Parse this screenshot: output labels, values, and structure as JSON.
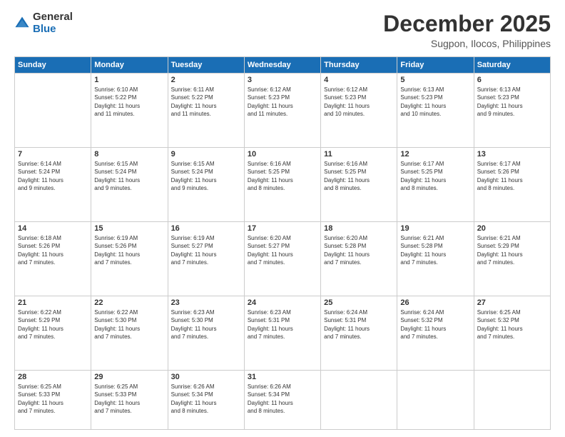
{
  "logo": {
    "general": "General",
    "blue": "Blue"
  },
  "title": "December 2025",
  "subtitle": "Sugpon, Ilocos, Philippines",
  "headers": [
    "Sunday",
    "Monday",
    "Tuesday",
    "Wednesday",
    "Thursday",
    "Friday",
    "Saturday"
  ],
  "weeks": [
    [
      {
        "day": "",
        "info": ""
      },
      {
        "day": "1",
        "info": "Sunrise: 6:10 AM\nSunset: 5:22 PM\nDaylight: 11 hours\nand 11 minutes."
      },
      {
        "day": "2",
        "info": "Sunrise: 6:11 AM\nSunset: 5:22 PM\nDaylight: 11 hours\nand 11 minutes."
      },
      {
        "day": "3",
        "info": "Sunrise: 6:12 AM\nSunset: 5:23 PM\nDaylight: 11 hours\nand 11 minutes."
      },
      {
        "day": "4",
        "info": "Sunrise: 6:12 AM\nSunset: 5:23 PM\nDaylight: 11 hours\nand 10 minutes."
      },
      {
        "day": "5",
        "info": "Sunrise: 6:13 AM\nSunset: 5:23 PM\nDaylight: 11 hours\nand 10 minutes."
      },
      {
        "day": "6",
        "info": "Sunrise: 6:13 AM\nSunset: 5:23 PM\nDaylight: 11 hours\nand 9 minutes."
      }
    ],
    [
      {
        "day": "7",
        "info": "Sunrise: 6:14 AM\nSunset: 5:24 PM\nDaylight: 11 hours\nand 9 minutes."
      },
      {
        "day": "8",
        "info": "Sunrise: 6:15 AM\nSunset: 5:24 PM\nDaylight: 11 hours\nand 9 minutes."
      },
      {
        "day": "9",
        "info": "Sunrise: 6:15 AM\nSunset: 5:24 PM\nDaylight: 11 hours\nand 9 minutes."
      },
      {
        "day": "10",
        "info": "Sunrise: 6:16 AM\nSunset: 5:25 PM\nDaylight: 11 hours\nand 8 minutes."
      },
      {
        "day": "11",
        "info": "Sunrise: 6:16 AM\nSunset: 5:25 PM\nDaylight: 11 hours\nand 8 minutes."
      },
      {
        "day": "12",
        "info": "Sunrise: 6:17 AM\nSunset: 5:25 PM\nDaylight: 11 hours\nand 8 minutes."
      },
      {
        "day": "13",
        "info": "Sunrise: 6:17 AM\nSunset: 5:26 PM\nDaylight: 11 hours\nand 8 minutes."
      }
    ],
    [
      {
        "day": "14",
        "info": "Sunrise: 6:18 AM\nSunset: 5:26 PM\nDaylight: 11 hours\nand 7 minutes."
      },
      {
        "day": "15",
        "info": "Sunrise: 6:19 AM\nSunset: 5:26 PM\nDaylight: 11 hours\nand 7 minutes."
      },
      {
        "day": "16",
        "info": "Sunrise: 6:19 AM\nSunset: 5:27 PM\nDaylight: 11 hours\nand 7 minutes."
      },
      {
        "day": "17",
        "info": "Sunrise: 6:20 AM\nSunset: 5:27 PM\nDaylight: 11 hours\nand 7 minutes."
      },
      {
        "day": "18",
        "info": "Sunrise: 6:20 AM\nSunset: 5:28 PM\nDaylight: 11 hours\nand 7 minutes."
      },
      {
        "day": "19",
        "info": "Sunrise: 6:21 AM\nSunset: 5:28 PM\nDaylight: 11 hours\nand 7 minutes."
      },
      {
        "day": "20",
        "info": "Sunrise: 6:21 AM\nSunset: 5:29 PM\nDaylight: 11 hours\nand 7 minutes."
      }
    ],
    [
      {
        "day": "21",
        "info": "Sunrise: 6:22 AM\nSunset: 5:29 PM\nDaylight: 11 hours\nand 7 minutes."
      },
      {
        "day": "22",
        "info": "Sunrise: 6:22 AM\nSunset: 5:30 PM\nDaylight: 11 hours\nand 7 minutes."
      },
      {
        "day": "23",
        "info": "Sunrise: 6:23 AM\nSunset: 5:30 PM\nDaylight: 11 hours\nand 7 minutes."
      },
      {
        "day": "24",
        "info": "Sunrise: 6:23 AM\nSunset: 5:31 PM\nDaylight: 11 hours\nand 7 minutes."
      },
      {
        "day": "25",
        "info": "Sunrise: 6:24 AM\nSunset: 5:31 PM\nDaylight: 11 hours\nand 7 minutes."
      },
      {
        "day": "26",
        "info": "Sunrise: 6:24 AM\nSunset: 5:32 PM\nDaylight: 11 hours\nand 7 minutes."
      },
      {
        "day": "27",
        "info": "Sunrise: 6:25 AM\nSunset: 5:32 PM\nDaylight: 11 hours\nand 7 minutes."
      }
    ],
    [
      {
        "day": "28",
        "info": "Sunrise: 6:25 AM\nSunset: 5:33 PM\nDaylight: 11 hours\nand 7 minutes."
      },
      {
        "day": "29",
        "info": "Sunrise: 6:25 AM\nSunset: 5:33 PM\nDaylight: 11 hours\nand 7 minutes."
      },
      {
        "day": "30",
        "info": "Sunrise: 6:26 AM\nSunset: 5:34 PM\nDaylight: 11 hours\nand 8 minutes."
      },
      {
        "day": "31",
        "info": "Sunrise: 6:26 AM\nSunset: 5:34 PM\nDaylight: 11 hours\nand 8 minutes."
      },
      {
        "day": "",
        "info": ""
      },
      {
        "day": "",
        "info": ""
      },
      {
        "day": "",
        "info": ""
      }
    ]
  ]
}
